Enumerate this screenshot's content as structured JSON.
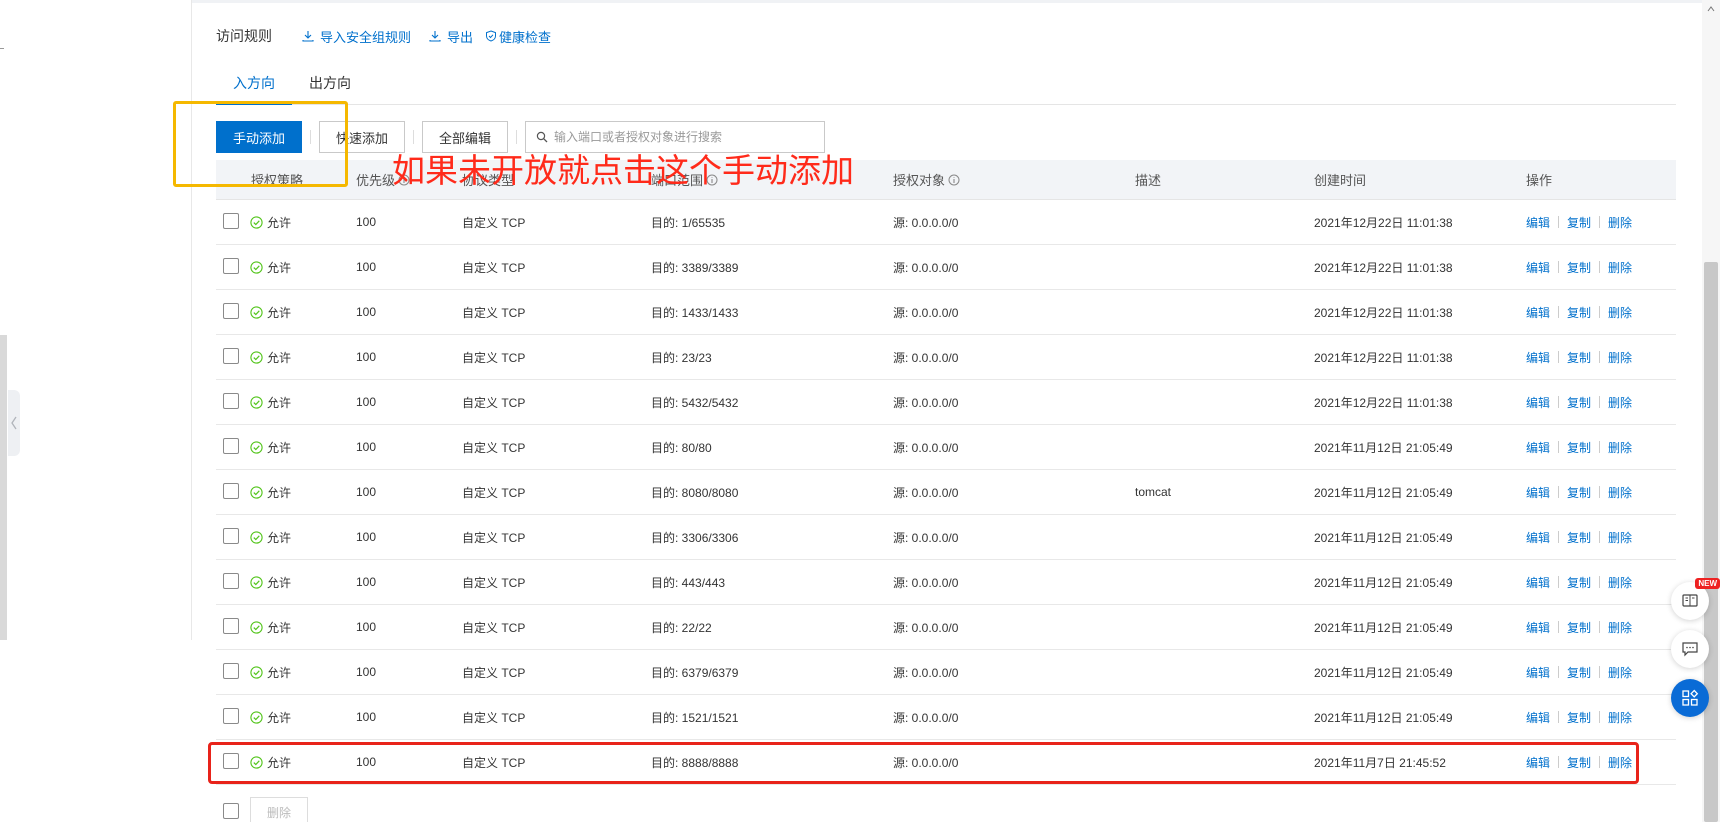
{
  "header": {
    "title": "访问规则",
    "links": [
      "导入安全组规则",
      "导出",
      "健康检查"
    ]
  },
  "tabs": [
    {
      "label": "入方向",
      "active": true
    },
    {
      "label": "出方向",
      "active": false
    }
  ],
  "toolbar": {
    "manual_add": "手动添加",
    "quick_add": "快速添加",
    "edit_all": "全部编辑",
    "search_placeholder": "输入端口或者授权对象进行搜索"
  },
  "table": {
    "columns": [
      "授权策略",
      "优先级",
      "协议类型",
      "端口范围",
      "授权对象",
      "描述",
      "创建时间",
      "操作"
    ],
    "ops": [
      "编辑",
      "复制",
      "删除"
    ],
    "rows": [
      {
        "policy": "允许",
        "priority": "100",
        "protocol": "自定义 TCP",
        "port": "目的: 1/65535",
        "source": "源: 0.0.0.0/0",
        "desc": "",
        "created": "2021年12月22日 11:01:38"
      },
      {
        "policy": "允许",
        "priority": "100",
        "protocol": "自定义 TCP",
        "port": "目的: 3389/3389",
        "source": "源: 0.0.0.0/0",
        "desc": "",
        "created": "2021年12月22日 11:01:38"
      },
      {
        "policy": "允许",
        "priority": "100",
        "protocol": "自定义 TCP",
        "port": "目的: 1433/1433",
        "source": "源: 0.0.0.0/0",
        "desc": "",
        "created": "2021年12月22日 11:01:38"
      },
      {
        "policy": "允许",
        "priority": "100",
        "protocol": "自定义 TCP",
        "port": "目的: 23/23",
        "source": "源: 0.0.0.0/0",
        "desc": "",
        "created": "2021年12月22日 11:01:38"
      },
      {
        "policy": "允许",
        "priority": "100",
        "protocol": "自定义 TCP",
        "port": "目的: 5432/5432",
        "source": "源: 0.0.0.0/0",
        "desc": "",
        "created": "2021年12月22日 11:01:38"
      },
      {
        "policy": "允许",
        "priority": "100",
        "protocol": "自定义 TCP",
        "port": "目的: 80/80",
        "source": "源: 0.0.0.0/0",
        "desc": "",
        "created": "2021年11月12日 21:05:49"
      },
      {
        "policy": "允许",
        "priority": "100",
        "protocol": "自定义 TCP",
        "port": "目的: 8080/8080",
        "source": "源: 0.0.0.0/0",
        "desc": "tomcat",
        "created": "2021年11月12日 21:05:49"
      },
      {
        "policy": "允许",
        "priority": "100",
        "protocol": "自定义 TCP",
        "port": "目的: 3306/3306",
        "source": "源: 0.0.0.0/0",
        "desc": "",
        "created": "2021年11月12日 21:05:49"
      },
      {
        "policy": "允许",
        "priority": "100",
        "protocol": "自定义 TCP",
        "port": "目的: 443/443",
        "source": "源: 0.0.0.0/0",
        "desc": "",
        "created": "2021年11月12日 21:05:49"
      },
      {
        "policy": "允许",
        "priority": "100",
        "protocol": "自定义 TCP",
        "port": "目的: 22/22",
        "source": "源: 0.0.0.0/0",
        "desc": "",
        "created": "2021年11月12日 21:05:49"
      },
      {
        "policy": "允许",
        "priority": "100",
        "protocol": "自定义 TCP",
        "port": "目的: 6379/6379",
        "source": "源: 0.0.0.0/0",
        "desc": "",
        "created": "2021年11月12日 21:05:49"
      },
      {
        "policy": "允许",
        "priority": "100",
        "protocol": "自定义 TCP",
        "port": "目的: 1521/1521",
        "source": "源: 0.0.0.0/0",
        "desc": "",
        "created": "2021年11月12日 21:05:49"
      },
      {
        "policy": "允许",
        "priority": "100",
        "protocol": "自定义 TCP",
        "port": "目的: 8888/8888",
        "source": "源: 0.0.0.0/0",
        "desc": "",
        "created": "2021年11月7日 21:45:52"
      }
    ]
  },
  "bottom": {
    "delete_label": "删除"
  },
  "annotation": {
    "text": "如果未开放就点击这个手动添加"
  },
  "float": {
    "new_badge": "NEW"
  },
  "colors": {
    "accent": "#0070cc",
    "success": "#52c41a",
    "annotation_red": "#e8231a",
    "annotation_yellow": "#f5b800"
  }
}
